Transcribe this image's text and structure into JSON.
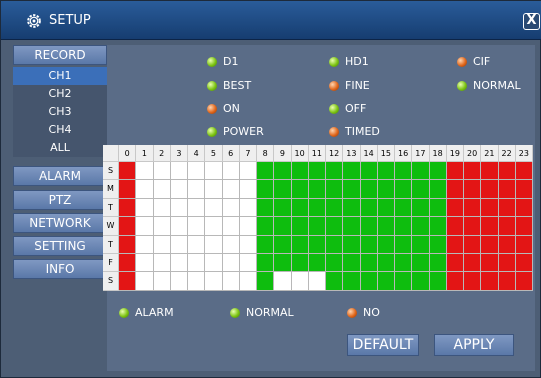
{
  "title": "SETUP",
  "close_label": "X",
  "sidebar": {
    "record": "RECORD",
    "channels": [
      "CH1",
      "CH2",
      "CH3",
      "CH4",
      "ALL"
    ],
    "alarm": "ALARM",
    "ptz": "PTZ",
    "network": "NETWORK",
    "setting": "SETTING",
    "info": "INFO"
  },
  "options": {
    "d1": "D1",
    "hd1": "HD1",
    "cif": "CIF",
    "best": "BEST",
    "fine": "FINE",
    "normal": "NORMAL",
    "on": "ON",
    "off": "OFF",
    "power": "POWER",
    "timed": "TIMED"
  },
  "schedule": {
    "hours": [
      "0",
      "1",
      "2",
      "3",
      "4",
      "5",
      "6",
      "7",
      "8",
      "9",
      "10",
      "11",
      "12",
      "13",
      "14",
      "15",
      "16",
      "17",
      "18",
      "19",
      "20",
      "21",
      "22",
      "23"
    ],
    "days": [
      "S",
      "M",
      "T",
      "W",
      "T",
      "F",
      "S"
    ],
    "rows": [
      "RWWWWWWWGGGGGGGGGGGRRRRR",
      "RWWWWWWWGGGGGGGGGGGRRRRR",
      "RWWWWWWWGGGGGGGGGGGRRRRR",
      "RWWWWWWWGGGGGGGGGGGRRRRR",
      "RWWWWWWWGGGGGGGGGGGRRRRR",
      "RWWWWWWWGGGGGGGGGGGRRRRR",
      "RWWWWWWWGWWWGGGGGGGRRRRR"
    ]
  },
  "legend": {
    "alarm": "ALARM",
    "normal": "NORMAL",
    "no": "NO"
  },
  "buttons": {
    "default": "DEFAULT",
    "apply": "APPLY"
  },
  "colors": {
    "red": "#e31515",
    "green": "#0ebd0e",
    "white": "#ffffff"
  }
}
